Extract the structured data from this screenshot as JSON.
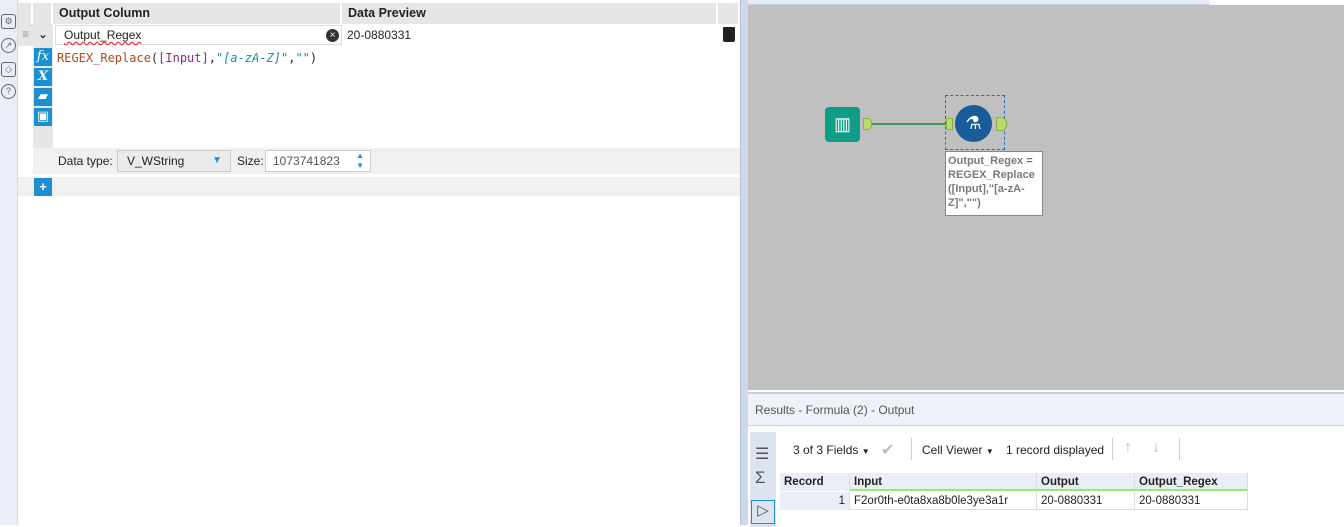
{
  "config": {
    "headers": {
      "output_column": "Output Column",
      "data_preview": "Data Preview"
    },
    "row": {
      "name": "Output_Regex",
      "preview": "20-0880331"
    },
    "expression": {
      "func": "REGEX_Replace",
      "open": "(",
      "field": "[Input]",
      "comma1": ",",
      "pattern": "\"[a-zA-Z]\"",
      "comma2": ",",
      "repl": "\"\"",
      "close": ")"
    },
    "data_type_label": "Data type:",
    "data_type": "V_WString",
    "size_label": "Size:",
    "size": "1073741823",
    "add": "+"
  },
  "canvas": {
    "annotation": "Output_Regex = REGEX_Replace ([Input],\"[a-zA-Z]\",\"\")"
  },
  "results": {
    "title": "Results - Formula (2) - Output",
    "fields": "3 of 3 Fields",
    "viewer": "Cell Viewer",
    "count": "1 record displayed",
    "columns": [
      "Record",
      "Input",
      "Output",
      "Output_Regex"
    ],
    "rows": [
      [
        "1",
        "F2or0th-e0ta8xa8b0le3ye3a1r",
        "20-0880331",
        "20-0880331"
      ]
    ]
  },
  "colors": {
    "accent": "#1b8fd0",
    "canvas": "#c0c0c0",
    "tool_green": "#0f9d8a",
    "formula_blue": "#1a5c99"
  }
}
